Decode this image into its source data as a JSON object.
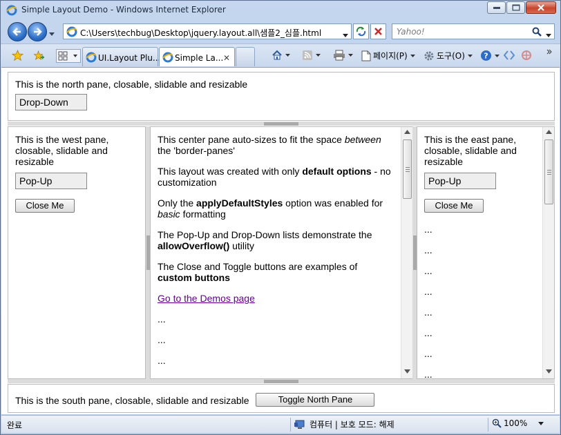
{
  "window": {
    "title": "Simple Layout Demo - Windows Internet Explorer"
  },
  "address_bar": {
    "url": "C:\\Users\\techbug\\Desktop\\jquery.layout.all\\샘플2_심플.html",
    "search_placeholder": "Yahoo!"
  },
  "tabs": [
    {
      "label": "UI.Layout Plu..."
    },
    {
      "label": "Simple La..."
    }
  ],
  "command_bar": {
    "page_label": "페이지(P)",
    "tools_label": "도구(O)"
  },
  "north": {
    "text": "This is the north pane, closable, slidable and resizable",
    "dropdown_label": "Drop-Down"
  },
  "west": {
    "text": "This is the west pane, closable, slidable and resizable",
    "popup_label": "Pop-Up",
    "close_label": "Close Me"
  },
  "center": {
    "p1_a": "This center pane auto-sizes to fit the space ",
    "p1_em": "between",
    "p1_b": " the 'border-panes'",
    "p2_a": "This layout was created with only ",
    "p2_b": "default options",
    "p2_c": " - no customization",
    "p3_a": "Only the ",
    "p3_b": "applyDefaultStyles",
    "p3_c": " option was enabled for ",
    "p3_em": "basic",
    "p3_d": " formatting",
    "p4_a": "The Pop-Up and Drop-Down lists demonstrate the ",
    "p4_b": "allowOverflow()",
    "p4_c": " utility",
    "p5_a": "The Close and Toggle buttons are examples of ",
    "p5_b": "custom buttons",
    "link": "Go to the Demos page",
    "ellipsis": "..."
  },
  "east": {
    "text": "This is the east pane, closable, slidable and resizable",
    "popup_label": "Pop-Up",
    "close_label": "Close Me",
    "ellipsis": "..."
  },
  "south": {
    "text": "This is the south pane, closable, slidable and resizable",
    "toggle_label": "Toggle North Pane"
  },
  "status_bar": {
    "status": "완료",
    "zone": "컴퓨터 | 보호 모드: 해제",
    "zoom": "100%"
  }
}
